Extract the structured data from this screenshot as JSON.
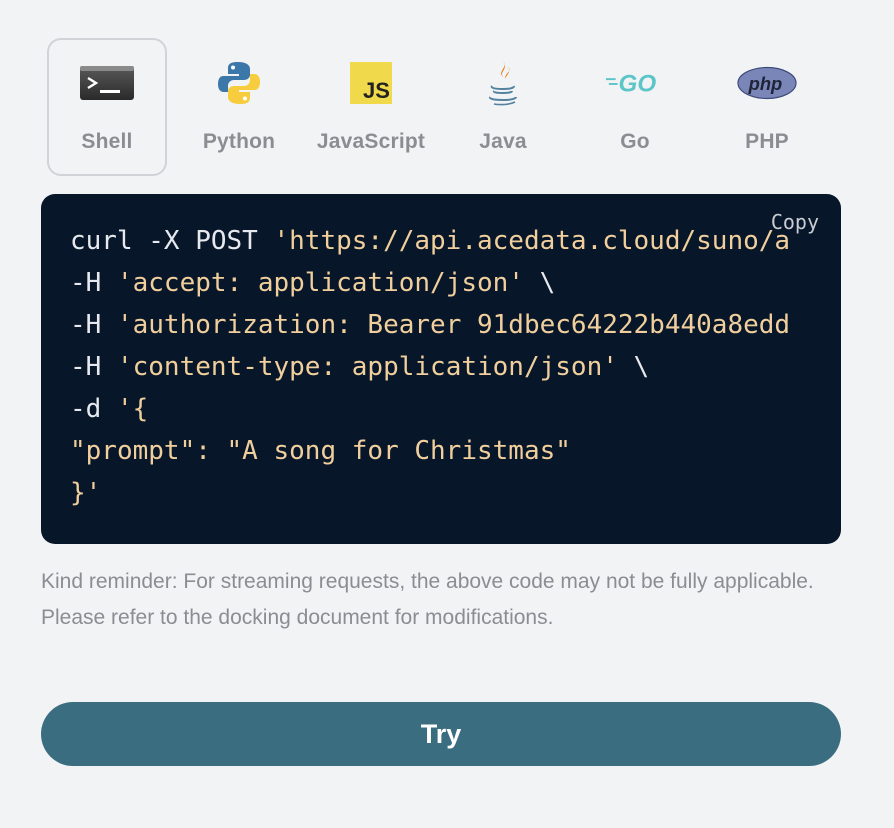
{
  "tabs": [
    {
      "id": "shell",
      "label": "Shell",
      "icon": "shell-terminal-icon",
      "active": true
    },
    {
      "id": "python",
      "label": "Python",
      "icon": "python-logo-icon",
      "active": false
    },
    {
      "id": "javascript",
      "label": "JavaScript",
      "icon": "javascript-logo-icon",
      "active": false
    },
    {
      "id": "java",
      "label": "Java",
      "icon": "java-logo-icon",
      "active": false
    },
    {
      "id": "go",
      "label": "Go",
      "icon": "go-logo-icon",
      "active": false
    },
    {
      "id": "php",
      "label": "PHP",
      "icon": "php-logo-icon",
      "active": false
    }
  ],
  "code": {
    "copy_label": "Copy",
    "lines": [
      {
        "plain": "curl -X POST ",
        "str": "'https://api.acedata.cloud/suno/a"
      },
      {
        "plain": "-H ",
        "str": "'accept: application/json'",
        "tail": " \\"
      },
      {
        "plain": "-H ",
        "str": "'authorization: Bearer 91dbec64222b440a8edd"
      },
      {
        "plain": "-H ",
        "str": "'content-type: application/json'",
        "tail": " \\"
      },
      {
        "plain": "-d ",
        "str": "'{"
      },
      {
        "plain": "",
        "str": "\"prompt\": \"A song for Christmas\""
      },
      {
        "plain": "",
        "str": "}'"
      }
    ]
  },
  "reminder": "Kind reminder: For streaming requests, the above code may not be fully applicable. Please refer to the docking document for modifications.",
  "try_label": "Try",
  "colors": {
    "code_bg": "#071629",
    "code_string": "#f0cf9d",
    "try_button": "#3b6d80",
    "page_bg": "#f2f3f5"
  }
}
